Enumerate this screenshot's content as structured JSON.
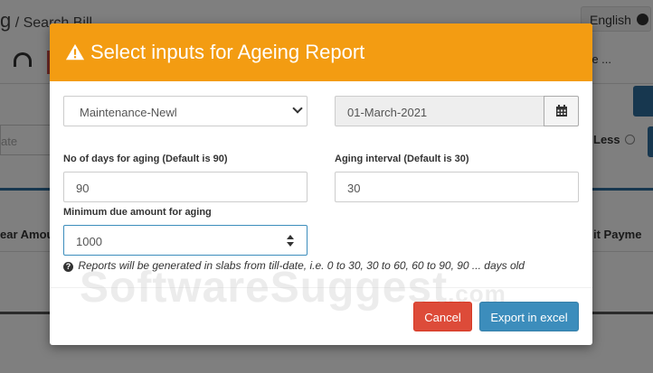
{
  "background": {
    "breadcrumb_lead": "g",
    "breadcrumb": "/ Search Bill",
    "language": "English",
    "more_menu": "re ...",
    "input_placeholder": "ate",
    "less_label": "Less",
    "col_left": "ear Amoun",
    "col_right": "it   Payme"
  },
  "modal": {
    "icon": "warning-icon",
    "title": "Select inputs for Ageing Report",
    "category_select": "Maintenance-Newl",
    "date_value": "01-March-2021",
    "calendar_icon": "calendar-icon",
    "aging_days_label": "No of days for aging (Default is 90)",
    "aging_days_value": "90",
    "aging_interval_label": "Aging interval (Default is 30)",
    "aging_interval_value": "30",
    "min_due_label": "Minimum due amount for aging",
    "min_due_value": "1000",
    "help_text": "Reports will be generated in slabs from till-date, i.e. 0 to 30, 30 to 60, 60 to 90, 90 ... days old",
    "cancel_label": "Cancel",
    "export_label": "Export in excel"
  },
  "watermark": {
    "text": "SoftwareSuggest",
    "suffix": ".com"
  },
  "colors": {
    "header": "#f39c12",
    "cancel": "#dd4b39",
    "export": "#3c8dbc"
  }
}
